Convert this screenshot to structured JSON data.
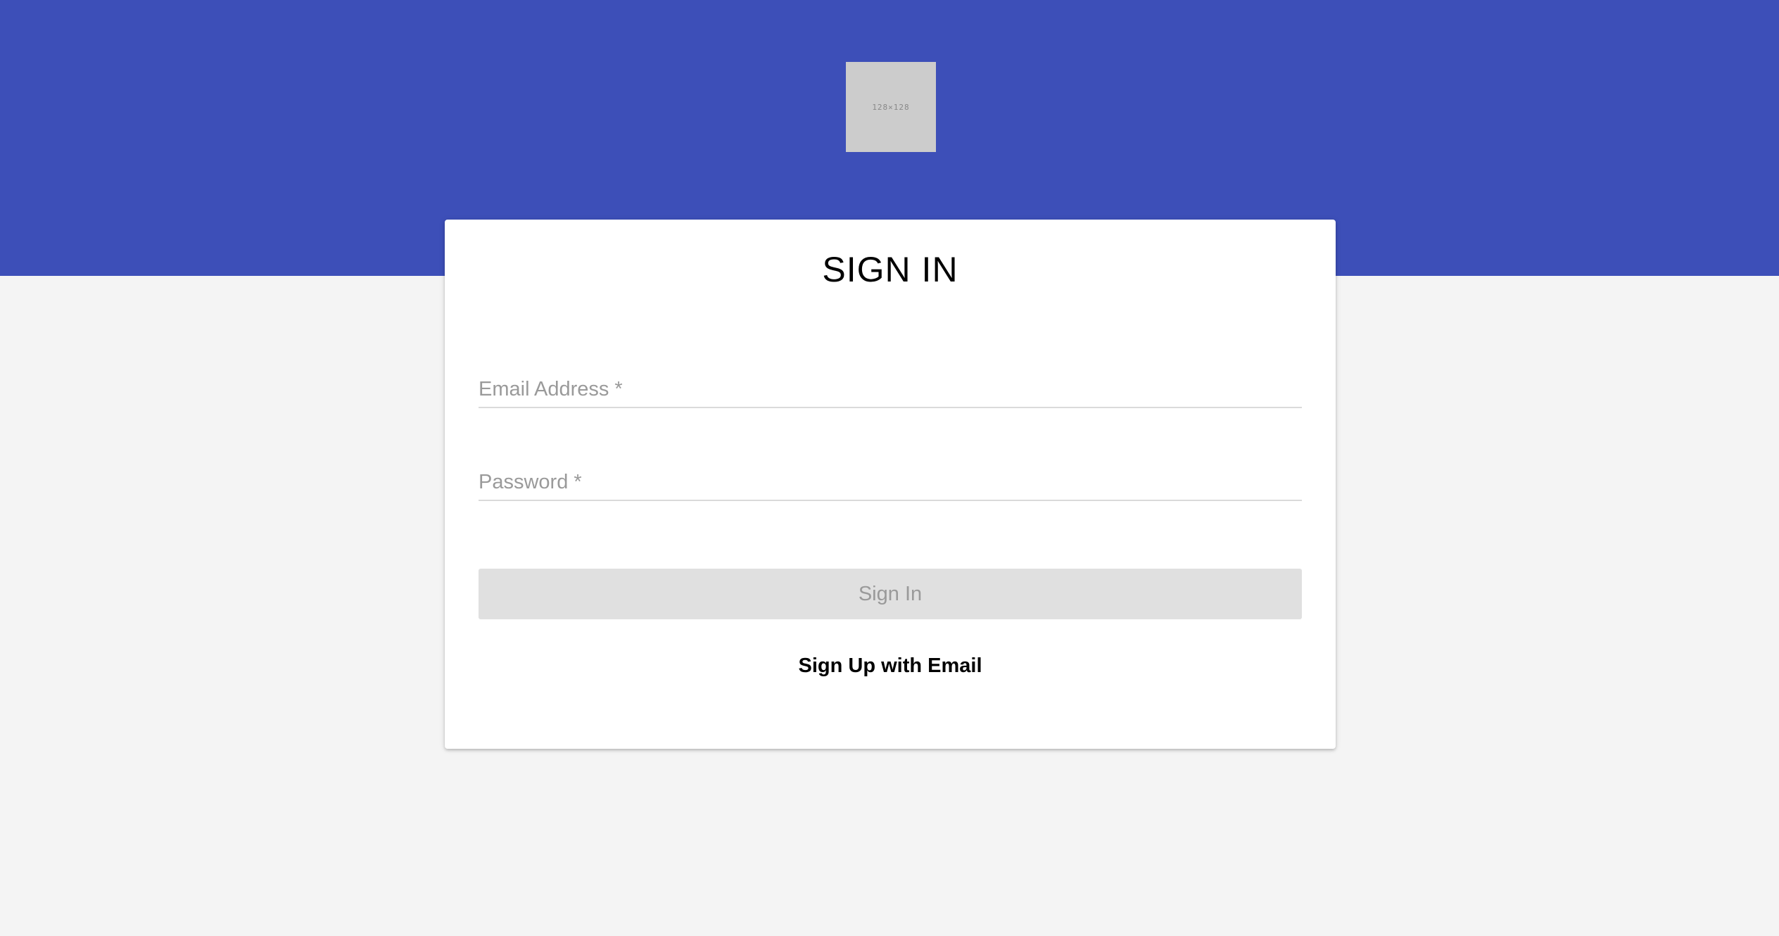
{
  "header": {
    "background_color": "#3d4fb8",
    "logo_placeholder_text": "128×128"
  },
  "signin_card": {
    "title": "SIGN IN",
    "email_label": "Email Address *",
    "password_label": "Password *",
    "signin_button_label": "Sign In",
    "signup_link_label": "Sign Up with Email"
  },
  "colors": {
    "page_background": "#f4f4f4",
    "card_background": "#ffffff",
    "disabled_button_background": "#e0e0e0",
    "disabled_text": "#9a9a9a"
  }
}
